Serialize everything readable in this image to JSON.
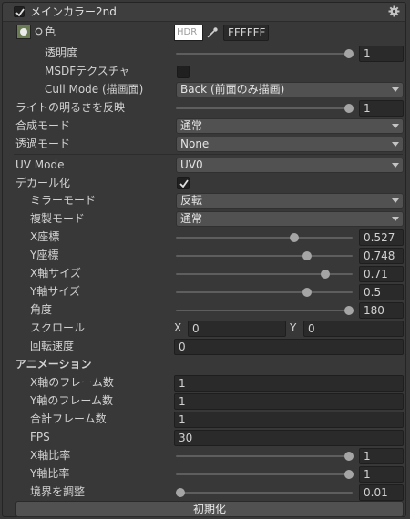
{
  "header": {
    "title": "メインカラー2nd",
    "enabled": true
  },
  "color": {
    "label": "色",
    "hdr_label": "HDR",
    "hex": "FFFFFF"
  },
  "opacity": {
    "label": "透明度",
    "value": "1",
    "fraction": 1.0
  },
  "msdf": {
    "label": "MSDFテクスチャ",
    "checked": false
  },
  "cull": {
    "label": "Cull Mode (描画面)",
    "value": "Back (前面のみ描画)"
  },
  "light": {
    "label": "ライトの明るさを反映",
    "value": "1",
    "fraction": 1.0
  },
  "blend": {
    "label": "合成モード",
    "value": "通常"
  },
  "alpha": {
    "label": "透過モード",
    "value": "None"
  },
  "uvmode": {
    "label": "UV Mode",
    "value": "UV0"
  },
  "decal": {
    "label": "デカール化",
    "checked": true
  },
  "mirror": {
    "label": "ミラーモード",
    "value": "反転"
  },
  "copy": {
    "label": "複製モード",
    "value": "通常"
  },
  "posx": {
    "label": "X座標",
    "value": "0.527",
    "fraction": 0.527
  },
  "posy": {
    "label": "Y座標",
    "value": "0.748",
    "fraction": 0.748
  },
  "sizex": {
    "label": "X軸サイズ",
    "value": "0.71",
    "fraction": 0.71
  },
  "sizey": {
    "label": "Y軸サイズ",
    "value": "0.5",
    "fraction": 0.5
  },
  "angle": {
    "label": "角度",
    "value": "180",
    "fraction": 1.0
  },
  "scroll": {
    "label": "スクロール",
    "x_label": "X",
    "x_value": "0",
    "y_label": "Y",
    "y_value": "0"
  },
  "rotspeed": {
    "label": "回転速度",
    "value": "0"
  },
  "anim": {
    "label": "アニメーション"
  },
  "framesx": {
    "label": "X軸のフレーム数",
    "value": "1"
  },
  "framesy": {
    "label": "Y軸のフレーム数",
    "value": "1"
  },
  "frames_total": {
    "label": "合計フレーム数",
    "value": "1"
  },
  "fps": {
    "label": "FPS",
    "value": "30"
  },
  "ratiox": {
    "label": "X軸比率",
    "value": "1",
    "fraction": 1.0
  },
  "ratioy": {
    "label": "Y軸比率",
    "value": "1",
    "fraction": 1.0
  },
  "border": {
    "label": "境界を調整",
    "value": "0.01",
    "fraction": 0.02
  },
  "reset": {
    "label": "初期化"
  },
  "colors": {
    "accent": "#d2d2d2",
    "panel": "#383838",
    "field": "#2a2a2a",
    "dropdown": "#515151"
  },
  "icons": [
    "checkmark-icon",
    "gear-icon",
    "texture-thumbnail-icon",
    "radio-icon",
    "eyedropper-icon",
    "dropdown-arrow-icon",
    "slider-thumb-icon"
  ]
}
